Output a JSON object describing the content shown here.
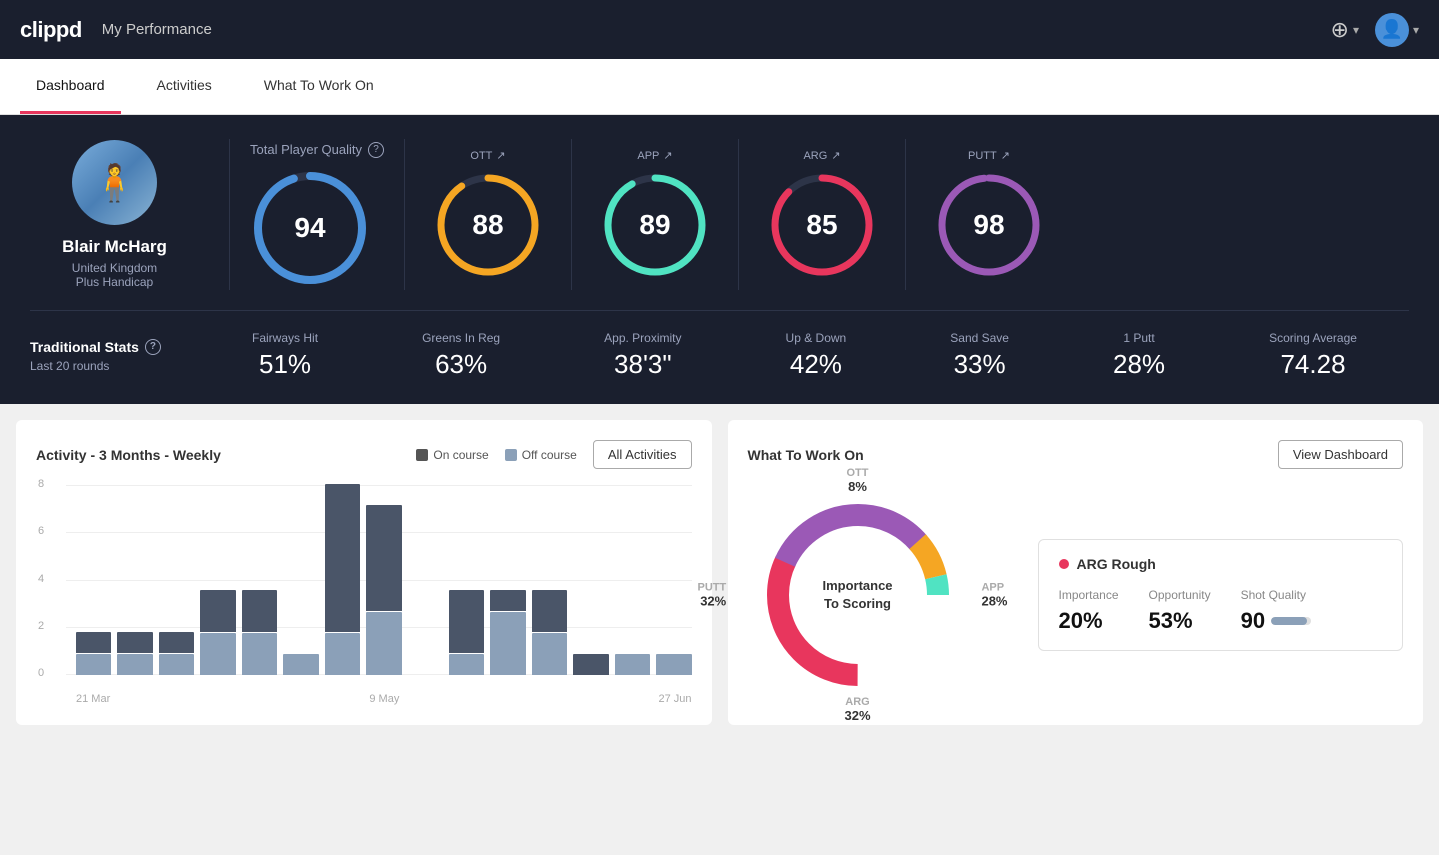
{
  "header": {
    "logo": "clippd",
    "title": "My Performance",
    "add_icon": "⊕",
    "add_label": "",
    "user_dropdown": "▾"
  },
  "tabs": [
    {
      "label": "Dashboard",
      "active": true
    },
    {
      "label": "Activities",
      "active": false
    },
    {
      "label": "What To Work On",
      "active": false
    }
  ],
  "player": {
    "name": "Blair McHarg",
    "country": "United Kingdom",
    "handicap": "Plus Handicap"
  },
  "quality": {
    "label": "Total Player Quality",
    "main_score": "94",
    "scores": [
      {
        "label": "OTT",
        "value": "88",
        "color": "#f5a623",
        "track": "#2d3448",
        "trend": "↗"
      },
      {
        "label": "APP",
        "value": "89",
        "color": "#50e3c2",
        "track": "#2d3448",
        "trend": "↗"
      },
      {
        "label": "ARG",
        "value": "85",
        "color": "#e8365d",
        "track": "#2d3448",
        "trend": "↗"
      },
      {
        "label": "PUTT",
        "value": "98",
        "color": "#9b59b6",
        "track": "#2d3448",
        "trend": "↗"
      }
    ]
  },
  "stats": {
    "label": "Traditional Stats",
    "sublabel": "Last 20 rounds",
    "items": [
      {
        "label": "Fairways Hit",
        "value": "51%"
      },
      {
        "label": "Greens In Reg",
        "value": "63%"
      },
      {
        "label": "App. Proximity",
        "value": "38'3\""
      },
      {
        "label": "Up & Down",
        "value": "42%"
      },
      {
        "label": "Sand Save",
        "value": "33%"
      },
      {
        "label": "1 Putt",
        "value": "28%"
      },
      {
        "label": "Scoring Average",
        "value": "74.28"
      }
    ]
  },
  "activity_chart": {
    "title": "Activity - 3 Months - Weekly",
    "legend_on": "On course",
    "legend_off": "Off course",
    "button": "All Activities",
    "y_labels": [
      "8",
      "6",
      "4",
      "2",
      "0"
    ],
    "x_labels": [
      "21 Mar",
      "9 May",
      "27 Jun"
    ],
    "bars": [
      {
        "on": 1,
        "off": 1
      },
      {
        "on": 1,
        "off": 1
      },
      {
        "on": 1,
        "off": 1
      },
      {
        "on": 2,
        "off": 2
      },
      {
        "on": 2,
        "off": 2
      },
      {
        "on": 0,
        "off": 1
      },
      {
        "on": 7,
        "off": 2
      },
      {
        "on": 5,
        "off": 3
      },
      {
        "on": 0,
        "off": 0
      },
      {
        "on": 3,
        "off": 1
      },
      {
        "on": 1,
        "off": 3
      },
      {
        "on": 2,
        "off": 2
      },
      {
        "on": 1,
        "off": 0
      },
      {
        "on": 0,
        "off": 1
      },
      {
        "on": 0,
        "off": 1
      }
    ],
    "max_y": 9
  },
  "wtwo": {
    "title": "What To Work On",
    "button": "View Dashboard",
    "donut_center_line1": "Importance",
    "donut_center_line2": "To Scoring",
    "segments": [
      {
        "label": "OTT",
        "percent": "8%",
        "color": "#f5a623",
        "position": "top"
      },
      {
        "label": "APP",
        "percent": "28%",
        "color": "#50e3c2",
        "position": "right"
      },
      {
        "label": "ARG",
        "percent": "32%",
        "color": "#e8365d",
        "position": "bottom"
      },
      {
        "label": "PUTT",
        "percent": "32%",
        "color": "#9b59b6",
        "position": "left"
      }
    ],
    "detail": {
      "title": "ARG Rough",
      "metrics": [
        {
          "label": "Importance",
          "value": "20%"
        },
        {
          "label": "Opportunity",
          "value": "53%"
        },
        {
          "label": "Shot Quality",
          "value": "90",
          "has_bar": true
        }
      ]
    }
  }
}
